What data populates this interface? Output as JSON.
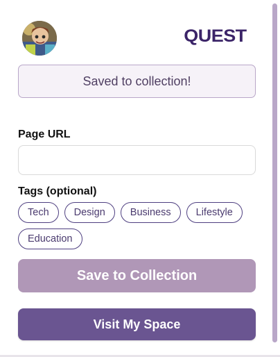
{
  "header": {
    "avatar_icon": "user-avatar",
    "logo_text": "QUEST"
  },
  "status": {
    "message": "Saved to collection!"
  },
  "form": {
    "url_label": "Page URL",
    "url_value": "",
    "tags_label": "Tags (optional)",
    "tags": [
      {
        "label": "Tech"
      },
      {
        "label": "Design"
      },
      {
        "label": "Business"
      },
      {
        "label": "Lifestyle"
      },
      {
        "label": "Education"
      }
    ]
  },
  "actions": {
    "save_label": "Save to Collection",
    "visit_label": "Visit My Space"
  },
  "colors": {
    "brand": "#3b2468",
    "tag_border": "#4e3f80",
    "save_button": "#b097b7",
    "visit_button": "#6a5591",
    "status_bg": "#f6f2f8"
  }
}
